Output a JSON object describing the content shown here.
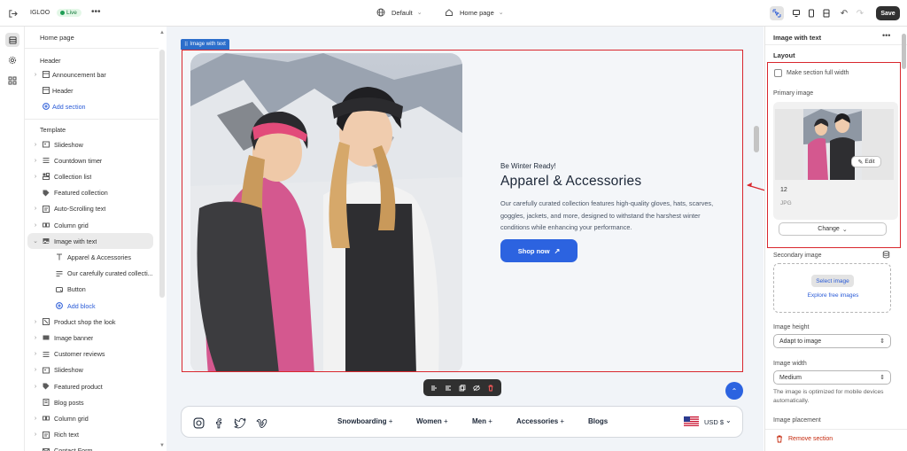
{
  "topbar": {
    "store_name": "IGLOO",
    "live_label": "Live",
    "theme_label": "Default",
    "page_label": "Home page",
    "save_label": "Save"
  },
  "sidebar": {
    "title": "Home page",
    "header_group": "Header",
    "header_items": [
      {
        "label": "Announcement bar"
      },
      {
        "label": "Header"
      }
    ],
    "add_section_label": "Add section",
    "template_group": "Template",
    "template_items": [
      {
        "label": "Slideshow"
      },
      {
        "label": "Countdown timer"
      },
      {
        "label": "Collection list"
      },
      {
        "label": "Featured collection"
      },
      {
        "label": "Auto-Scrolling text"
      },
      {
        "label": "Column grid"
      },
      {
        "label": "Image with text"
      },
      {
        "label": "Apparel & Accessories"
      },
      {
        "label": "Our carefully curated collecti..."
      },
      {
        "label": "Button"
      },
      {
        "label": "Add block"
      },
      {
        "label": "Product shop the look"
      },
      {
        "label": "Image banner"
      },
      {
        "label": "Customer reviews"
      },
      {
        "label": "Slideshow"
      },
      {
        "label": "Featured product"
      },
      {
        "label": "Blog posts"
      },
      {
        "label": "Column grid"
      },
      {
        "label": "Rich text"
      },
      {
        "label": "Contact Form"
      }
    ]
  },
  "preview": {
    "section_tag": "Image with text",
    "subheading": "Be Winter Ready!",
    "heading": "Apparel & Accessories",
    "body": "Our carefully curated collection features high-quality gloves, hats, scarves, goggles, jackets, and more, designed to withstand the harshest winter conditions while enhancing your performance.",
    "button_label": "Shop now",
    "nav": [
      "Snowboarding",
      "Women",
      "Men",
      "Accessories",
      "Blogs"
    ],
    "currency": "USD $"
  },
  "panel": {
    "title": "Image with text",
    "layout_heading": "Layout",
    "full_width_label": "Make section full width",
    "primary_image_label": "Primary image",
    "edit_label": "Edit",
    "image_name": "12",
    "image_type": "JPG",
    "change_label": "Change",
    "secondary_image_label": "Secondary image",
    "select_image_label": "Select image",
    "explore_label": "Explore free images",
    "image_height_label": "Image height",
    "image_height_value": "Adapt to image",
    "image_width_label": "Image width",
    "image_width_value": "Medium",
    "width_help": "The image is optimized for mobile devices automatically.",
    "image_placement_label": "Image placement",
    "remove_label": "Remove section"
  },
  "colors": {
    "accent": "#2c63e0",
    "highlight": "#d9272e"
  }
}
